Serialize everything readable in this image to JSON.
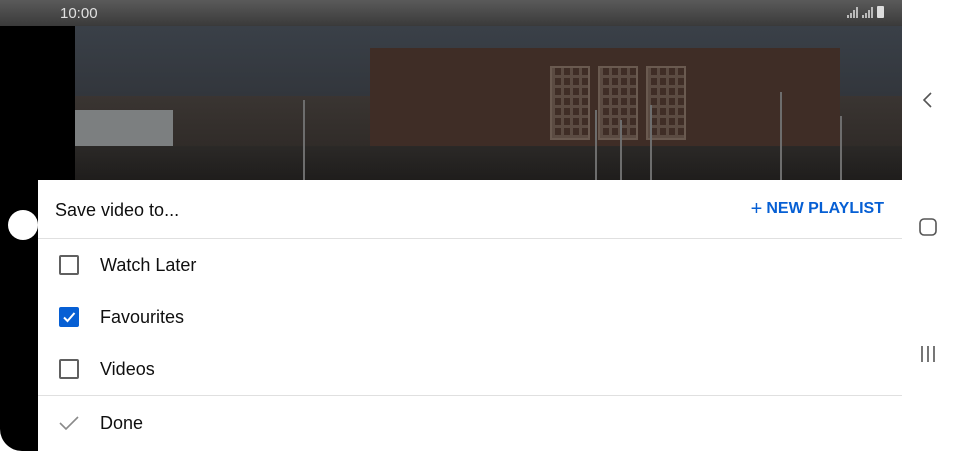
{
  "status_bar": {
    "time": "10:00"
  },
  "sheet": {
    "title": "Save video to...",
    "new_playlist_icon": "+",
    "new_playlist_label": "NEW PLAYLIST",
    "playlists": [
      {
        "label": "Watch Later",
        "checked": false
      },
      {
        "label": "Favourites",
        "checked": true
      },
      {
        "label": "Videos",
        "checked": false
      }
    ],
    "done_label": "Done"
  },
  "icons": {
    "checkbox_checked": "check-icon",
    "done": "checkmark-icon",
    "nav_back": "back-icon",
    "nav_home": "home-icon",
    "nav_recents": "recents-icon"
  },
  "colors": {
    "accent": "#065fd4",
    "text": "#0f0f0f",
    "divider": "#e0e0e0"
  }
}
